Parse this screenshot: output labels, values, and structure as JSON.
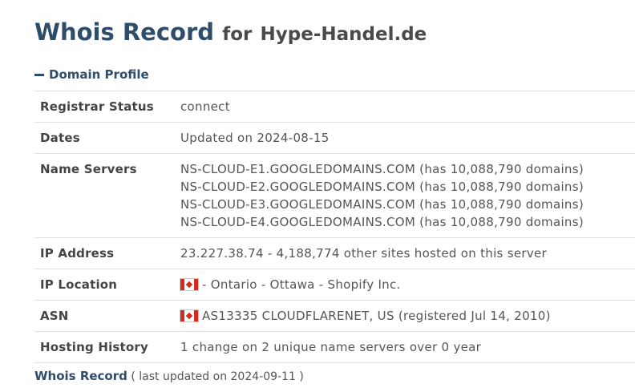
{
  "header": {
    "title_main": "Whois Record",
    "title_for": "for",
    "domain": "Hype-Handel.de"
  },
  "section": {
    "label": "Domain Profile",
    "toggle_icon": "minus-icon"
  },
  "profile": {
    "registrar_status": {
      "label": "Registrar Status",
      "value": "connect"
    },
    "dates": {
      "label": "Dates",
      "value": "Updated on 2024-08-15"
    },
    "name_servers": {
      "label": "Name Servers",
      "values": [
        "NS-CLOUD-E1.GOOGLEDOMAINS.COM (has 10,088,790 domains)",
        "NS-CLOUD-E2.GOOGLEDOMAINS.COM (has 10,088,790 domains)",
        "NS-CLOUD-E3.GOOGLEDOMAINS.COM (has 10,088,790 domains)",
        "NS-CLOUD-E4.GOOGLEDOMAINS.COM (has 10,088,790 domains)"
      ]
    },
    "ip_address": {
      "label": "IP Address",
      "value": "23.227.38.74 - 4,188,774 other sites hosted on this server"
    },
    "ip_location": {
      "label": "IP Location",
      "flag": "canada-flag-icon",
      "value": "- Ontario - Ottawa - Shopify Inc."
    },
    "asn": {
      "label": "ASN",
      "flag": "canada-flag-icon",
      "value": "AS13335 CLOUDFLARENET, US (registered Jul 14, 2010)"
    },
    "hosting_history": {
      "label": "Hosting History",
      "value": "1 change on 2 unique name servers over 0 year"
    }
  },
  "footer": {
    "link": "Whois Record",
    "note": "( last updated on 2024-09-11 )"
  },
  "colors": {
    "accent": "#2e4d6b",
    "text": "#555555",
    "border": "#e0e0e0",
    "flag_red": "#d52b1e"
  }
}
